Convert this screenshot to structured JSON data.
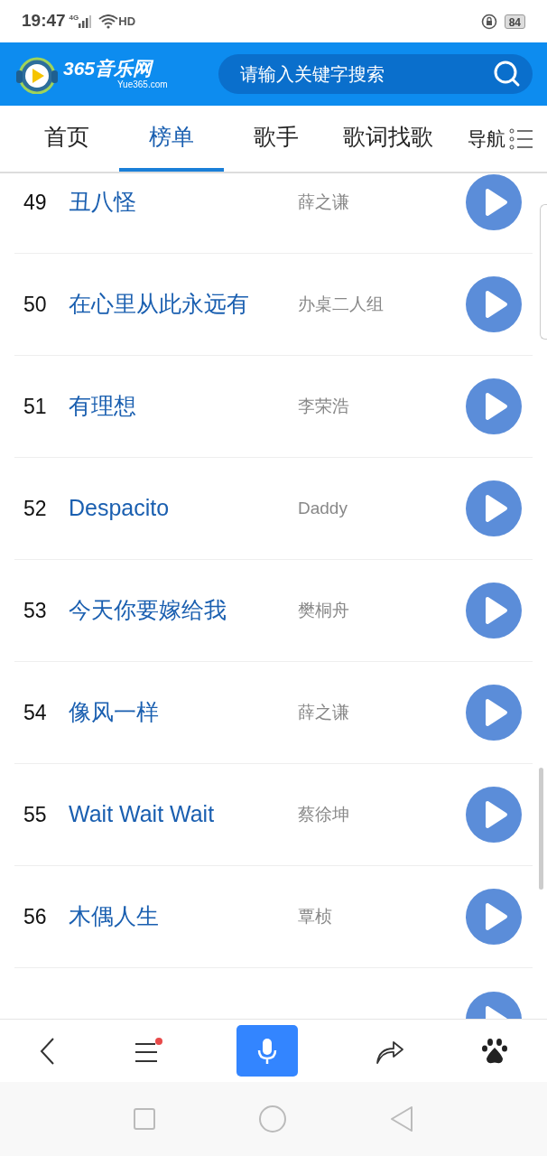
{
  "status_bar": {
    "time": "19:47",
    "network": "4G",
    "hd": "HD",
    "battery": "84"
  },
  "header": {
    "logo_text": "365音乐网",
    "logo_domain": "Yue365.com",
    "search": {
      "placeholder": "请输入关键字搜索"
    }
  },
  "nav": {
    "tabs": [
      {
        "label": "首页",
        "selected": false
      },
      {
        "label": "榜单",
        "selected": true
      },
      {
        "label": "歌手",
        "selected": false
      },
      {
        "label": "歌词找歌",
        "selected": false
      }
    ],
    "menu": "导航"
  },
  "songs": [
    {
      "rank": "49",
      "title": "丑八怪",
      "artist": "薛之谦"
    },
    {
      "rank": "50",
      "title": "在心里从此永远有",
      "artist": "办桌二人组"
    },
    {
      "rank": "51",
      "title": "有理想",
      "artist": "李荣浩"
    },
    {
      "rank": "52",
      "title": "Despacito",
      "artist": "Daddy"
    },
    {
      "rank": "53",
      "title": "今天你要嫁给我",
      "artist": "樊桐舟"
    },
    {
      "rank": "54",
      "title": "像风一样",
      "artist": "薛之谦"
    },
    {
      "rank": "55",
      "title": "Wait Wait Wait",
      "artist": "蔡徐坤"
    },
    {
      "rank": "56",
      "title": "木偶人生",
      "artist": "覃桢"
    }
  ],
  "toolbar": {
    "menu_badge": true
  }
}
